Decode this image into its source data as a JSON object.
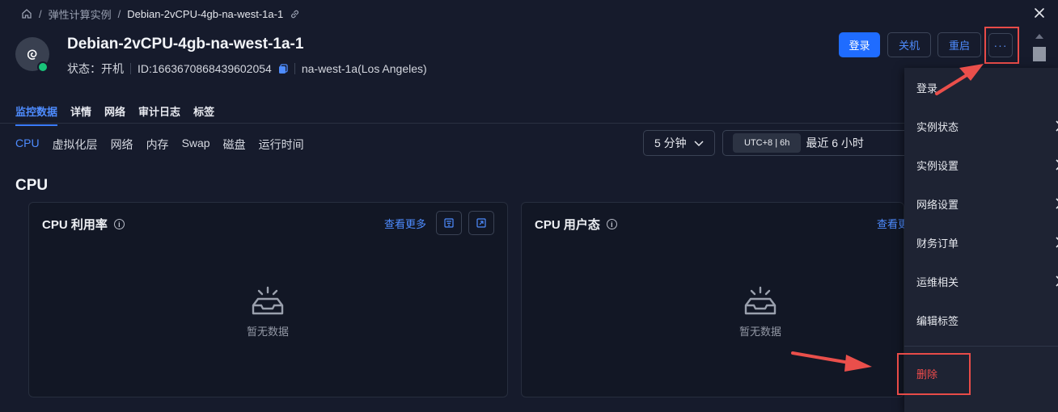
{
  "breadcrumb": {
    "items": [
      "弹性计算实例",
      "Debian-2vCPU-4gb-na-west-1a-1"
    ],
    "separator": "/"
  },
  "instance": {
    "name": "Debian-2vCPU-4gb-na-west-1a-1",
    "status_label": "状态：",
    "status_value": "开机",
    "id_text": "ID:1663670868439602054",
    "region": "na-west-1a(Los Angeles)"
  },
  "actions": {
    "login": "登录",
    "shutdown": "关机",
    "restart": "重启",
    "more": "···"
  },
  "tabs": [
    {
      "label": "监控数据",
      "active": true
    },
    {
      "label": "详情"
    },
    {
      "label": "网络"
    },
    {
      "label": "审计日志"
    },
    {
      "label": "标签"
    }
  ],
  "subtabs": [
    {
      "label": "CPU",
      "active": true
    },
    {
      "label": "虚拟化层"
    },
    {
      "label": "网络"
    },
    {
      "label": "内存"
    },
    {
      "label": "Swap"
    },
    {
      "label": "磁盘"
    },
    {
      "label": "运行时间"
    }
  ],
  "controls": {
    "interval": "5 分钟",
    "timezone": "UTC+8 | 6h",
    "range": "最近 6 小时"
  },
  "section": {
    "title": "CPU"
  },
  "panels": [
    {
      "title": "CPU 利用率",
      "more": "查看更多",
      "empty_text": "暂无数据"
    },
    {
      "title": "CPU 用户态",
      "more": "查看更多",
      "empty_text": "暂无数据"
    }
  ],
  "menu": {
    "items": [
      "登录",
      "实例状态",
      "实例设置",
      "网络设置",
      "财务订单",
      "运维相关",
      "编辑标签"
    ],
    "danger_item": "删除"
  },
  "colors": {
    "accent": "#1f6cff",
    "link": "#4e8cff",
    "danger": "#f04c4c",
    "online": "#19c47a",
    "annotation": "#e84b48"
  }
}
